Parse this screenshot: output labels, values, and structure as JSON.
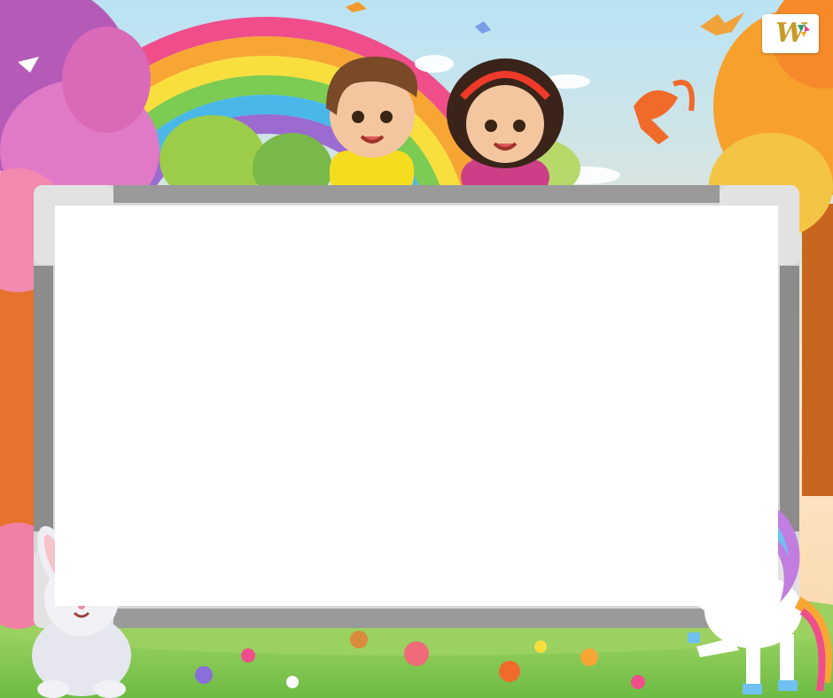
{
  "logo": {
    "text": "W",
    "icon": "logo-icon"
  },
  "board": {
    "surface_color": "#ffffff",
    "frame_color": "#9a9a9a"
  },
  "characters": [
    "boy-icon",
    "girl-icon",
    "bunny-icon",
    "unicorn-icon"
  ],
  "decorations": [
    "rainbow-icon",
    "bird-icon",
    "squirrel-icon",
    "tree-icon",
    "flower-icon"
  ],
  "colors": {
    "sky": "#9fd8f2",
    "grass": "#8ccf5a",
    "tree_left": "#d067b9",
    "tree_right": "#f39a2b"
  }
}
